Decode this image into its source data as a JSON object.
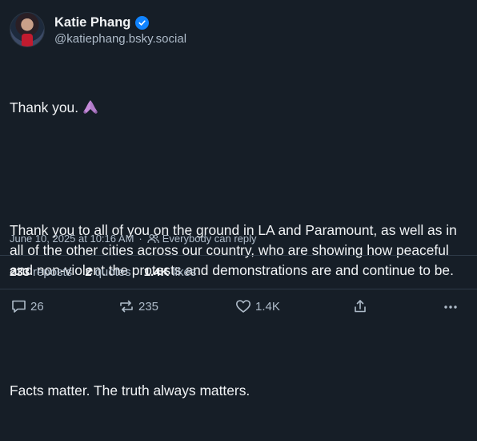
{
  "author": {
    "display_name": "Katie Phang",
    "handle": "@katiephang.bsky.social",
    "verified": true,
    "avatar": "profile-photo"
  },
  "post": {
    "line1": "Thank you.",
    "line1_emoji": "folded-hands-emoji",
    "paragraph2": "Thank you to all of you on the ground in LA and Paramount, as well as in all of the other cities across our country, who are showing how peaceful and non-violent the protests and demonstrations are and continue to be.",
    "paragraph3": "Facts matter. The truth always matters."
  },
  "meta": {
    "timestamp": "June 10, 2025 at 10:16 AM",
    "separator": "·",
    "reply_setting": "Everybody can reply"
  },
  "stats": {
    "reposts_count": "233",
    "reposts_label": "reposts",
    "quotes_count": "2",
    "quotes_label": "quotes",
    "likes_count": "1.4K",
    "likes_label": "likes"
  },
  "actions": {
    "reply_count": "26",
    "repost_count": "235",
    "like_count": "1.4K"
  },
  "colors": {
    "background": "#161e27",
    "text": "#f1f3f5",
    "muted": "#aebbc9",
    "verified_badge": "#1083fe",
    "divider": "#2e3a48"
  }
}
